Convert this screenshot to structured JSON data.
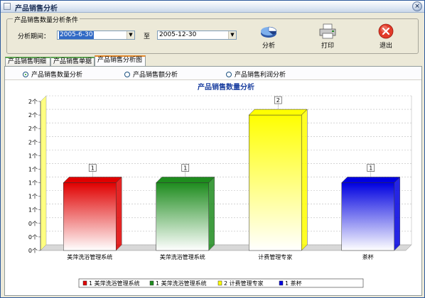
{
  "window": {
    "title": "产品销售分析",
    "close_glyph": "×"
  },
  "conditions": {
    "legend": "产品销售数量分析条件",
    "period_label": "分析期间：",
    "start_value": "2005-6-30",
    "to_label": "至",
    "end_value": "2005-12-30"
  },
  "toolbar": {
    "analyze": "分析",
    "print": "打印",
    "exit": "退出"
  },
  "tabs": [
    {
      "label": "产品销售明细"
    },
    {
      "label": "产品销售单据"
    },
    {
      "label": "产品销售分析图"
    }
  ],
  "options": [
    {
      "label": "产品销售数量分析",
      "selected": true
    },
    {
      "label": "产品销售额分析",
      "selected": false
    },
    {
      "label": "产品销售利润分析",
      "selected": false
    }
  ],
  "chart_data": {
    "type": "bar",
    "title": "产品销售数量分析",
    "categories": [
      "美萍洗浴管理系统",
      "美萍洗浴管理系统",
      "计费管理专家",
      "茶杯"
    ],
    "values": [
      1,
      1,
      2,
      1
    ],
    "data_labels": [
      "1",
      "1",
      "2",
      "1"
    ],
    "colors": [
      "#e00000",
      "#1e8c1e",
      "#ffff00",
      "#0000e0"
    ],
    "y_tick_labels": [
      "0个",
      "0个",
      "0个",
      "1个",
      "1个",
      "1个",
      "1个",
      "1个",
      "2个",
      "2个",
      "2个",
      "2个"
    ],
    "ylim": [
      0,
      2.2
    ],
    "legend": [
      "1 美萍洗浴管理系统",
      "1 美萍洗浴管理系统",
      "2 计费管理专家",
      "1 茶杯"
    ],
    "legend_position": "bottom",
    "grid": true
  }
}
